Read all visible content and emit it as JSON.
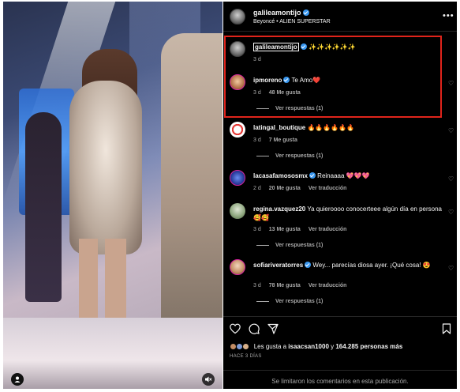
{
  "post": {
    "author": "galileamontijo",
    "audio": "Beyoncé • ALIEN SUPERSTAR",
    "caption": {
      "user": "galileamontijo",
      "text": "✨✨✨✨✨✨",
      "time": "3 d"
    }
  },
  "comments": [
    {
      "user": "ipmoreno",
      "verified": true,
      "text": "Te Amo❤️",
      "time": "3 d",
      "likes": "48 Me gusta",
      "reply_label": "Responder",
      "view_replies": "Ver respuestas (1)"
    },
    {
      "user": "latingal_boutique",
      "verified": false,
      "text": "🔥🔥🔥🔥🔥🔥",
      "time": "3 d",
      "likes": "7 Me gusta",
      "view_replies": "Ver respuestas (1)"
    },
    {
      "user": "lacasafamososmx",
      "verified": true,
      "text": "Reinaaaa 💖💖💖",
      "time": "2 d",
      "likes": "20 Me gusta",
      "translate": "Ver traducción"
    },
    {
      "user": "regina.vazquez20",
      "verified": false,
      "text": "Ya quieroooo conocerteee algún día en persona🥰🥰",
      "time": "3 d",
      "likes": "13 Me gusta",
      "translate": "Ver traducción",
      "view_replies": "Ver respuestas (1)"
    },
    {
      "user": "sofiariveratorres",
      "verified": true,
      "text": "Wey... parecías diosa ayer. ¡Qué cosa! 😍",
      "time": "3 d",
      "likes": "78 Me gusta",
      "translate": "Ver traducción",
      "view_replies": "Ver respuestas (1)"
    }
  ],
  "likes_summary": {
    "prefix": "Les gusta a ",
    "user": "isaacsan1000",
    "middle": " y ",
    "count": "164.285 personas más"
  },
  "date": "HACE 3 DÍAS",
  "footer": "Se limitaron los comentarios en esta publicación.",
  "icons": {
    "like": "heart-icon",
    "comment": "comment-icon",
    "share": "share-icon",
    "save": "bookmark-icon",
    "more": "more-icon",
    "mute": "mute-icon",
    "tagged": "user-icon"
  },
  "colors": {
    "panel_bg": "#000000",
    "text": "#f5f5f5",
    "muted": "#a8a8a8",
    "verified": "#3897f0",
    "highlight": "#e0241b"
  }
}
